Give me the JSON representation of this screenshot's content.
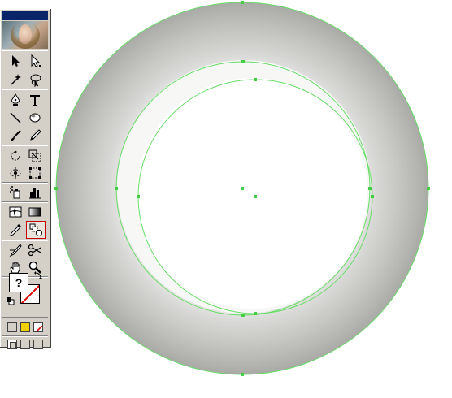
{
  "toolbox": {
    "selected_tool": "blend-tool",
    "fill_label": "?",
    "tools": [
      {
        "name": "selection-tool-icon"
      },
      {
        "name": "direct-selection-tool-icon"
      },
      {
        "name": "magic-wand-tool-icon"
      },
      {
        "name": "lasso-tool-icon"
      },
      {
        "name": "pen-tool-icon"
      },
      {
        "name": "type-tool-icon"
      },
      {
        "name": "line-segment-tool-icon"
      },
      {
        "name": "ellipse-tool-icon"
      },
      {
        "name": "paintbrush-tool-icon"
      },
      {
        "name": "pencil-tool-icon"
      },
      {
        "name": "rotate-tool-icon"
      },
      {
        "name": "scale-tool-icon"
      },
      {
        "name": "warp-tool-icon"
      },
      {
        "name": "free-transform-tool-icon"
      },
      {
        "name": "symbol-sprayer-tool-icon"
      },
      {
        "name": "column-graph-tool-icon"
      },
      {
        "name": "mesh-tool-icon"
      },
      {
        "name": "gradient-tool-icon"
      },
      {
        "name": "eyedropper-tool-icon"
      },
      {
        "name": "blend-tool-icon"
      },
      {
        "name": "slice-tool-icon"
      },
      {
        "name": "scissors-tool-icon"
      },
      {
        "name": "hand-tool-icon"
      },
      {
        "name": "zoom-tool-icon"
      }
    ]
  },
  "colors": {
    "selection": "#66dd66",
    "ring_outer": "#a9aaa6",
    "ring_inner": "#f4f4f2",
    "stroke_none": "#e00000"
  }
}
